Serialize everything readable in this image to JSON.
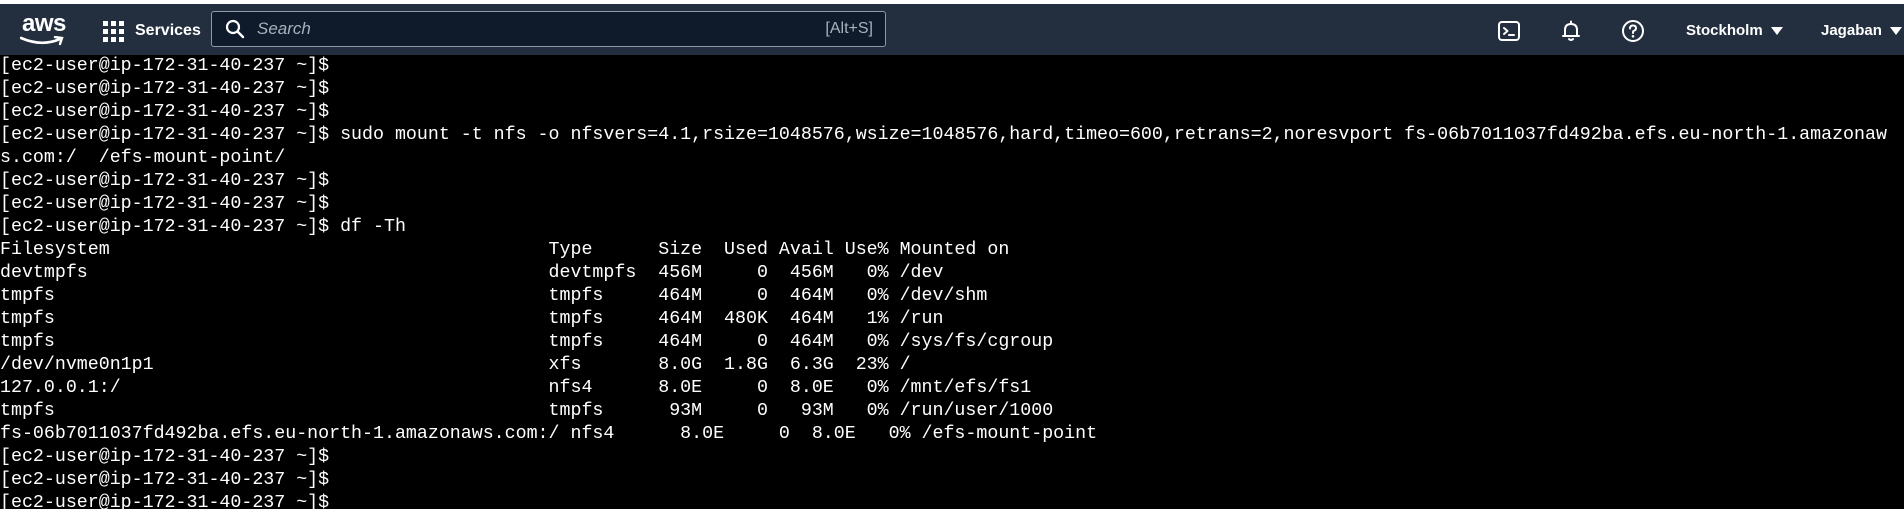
{
  "header": {
    "logo_text": "aws",
    "services_label": "Services",
    "search_placeholder": "Search",
    "search_shortcut": "[Alt+S]",
    "region": "Stockholm",
    "user": "Jagaban",
    "icons": [
      "cloudshell-icon",
      "bell-icon",
      "help-icon"
    ]
  },
  "terminal": {
    "lines": [
      "[ec2-user@ip-172-31-40-237 ~]$",
      "[ec2-user@ip-172-31-40-237 ~]$",
      "[ec2-user@ip-172-31-40-237 ~]$",
      "[ec2-user@ip-172-31-40-237 ~]$ sudo mount -t nfs -o nfsvers=4.1,rsize=1048576,wsize=1048576,hard,timeo=600,retrans=2,noresvport fs-06b7011037fd492ba.efs.eu-north-1.amazonaw",
      "s.com:/  /efs-mount-point/",
      "[ec2-user@ip-172-31-40-237 ~]$",
      "[ec2-user@ip-172-31-40-237 ~]$",
      "[ec2-user@ip-172-31-40-237 ~]$ df -Th",
      "Filesystem                                        Type      Size  Used Avail Use% Mounted on",
      "devtmpfs                                          devtmpfs  456M     0  456M   0% /dev",
      "tmpfs                                             tmpfs     464M     0  464M   0% /dev/shm",
      "tmpfs                                             tmpfs     464M  480K  464M   1% /run",
      "tmpfs                                             tmpfs     464M     0  464M   0% /sys/fs/cgroup",
      "/dev/nvme0n1p1                                    xfs       8.0G  1.8G  6.3G  23% /",
      "127.0.0.1:/                                       nfs4      8.0E     0  8.0E   0% /mnt/efs/fs1",
      "tmpfs                                             tmpfs      93M     0   93M   0% /run/user/1000",
      "fs-06b7011037fd492ba.efs.eu-north-1.amazonaws.com:/ nfs4      8.0E     0  8.0E   0% /efs-mount-point",
      "[ec2-user@ip-172-31-40-237 ~]$",
      "[ec2-user@ip-172-31-40-237 ~]$",
      "[ec2-user@ip-172-31-40-237 ~]$"
    ]
  }
}
